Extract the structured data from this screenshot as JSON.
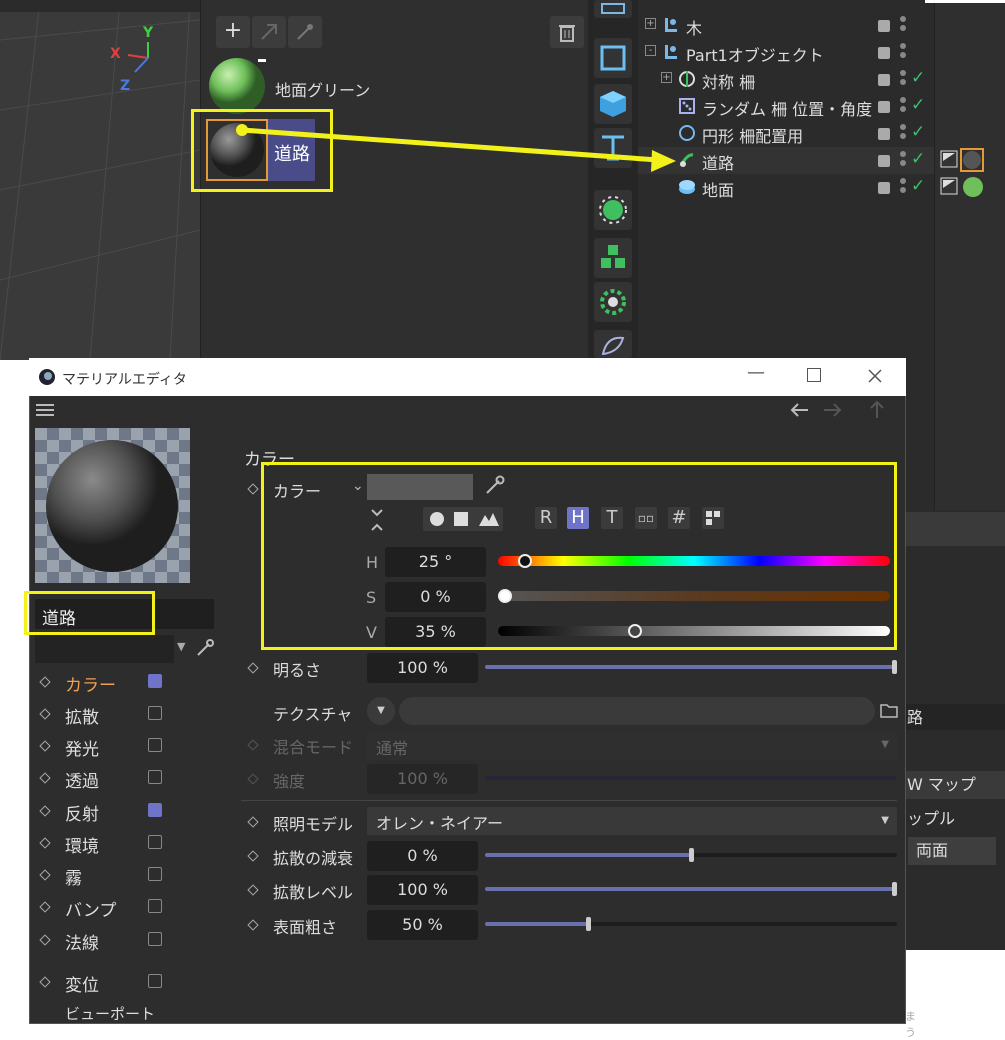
{
  "viewport": {
    "axis_x": "X",
    "axis_y": "Y",
    "axis_z": "Z"
  },
  "material_manager": {
    "add_label": "+",
    "materials": [
      {
        "name": "地面グリーン"
      },
      {
        "name": "道路"
      }
    ]
  },
  "object_manager": {
    "rows": [
      {
        "label": "木"
      },
      {
        "label": "Part1オブジェクト"
      },
      {
        "label": "対称 柵"
      },
      {
        "label": "ランダム 柵 位置・角度"
      },
      {
        "label": "円形 柵配置用"
      },
      {
        "label": "道路"
      },
      {
        "label": "地面"
      }
    ]
  },
  "side_attr": {
    "item1": "路",
    "item2": "W マップ",
    "item3": "ップル",
    "item4": "両面",
    "item5": "まう"
  },
  "material_editor": {
    "title": "マテリアルエディタ",
    "material_name": "道路",
    "channels": [
      {
        "label": "カラー",
        "checked": true
      },
      {
        "label": "拡散",
        "checked": false
      },
      {
        "label": "発光",
        "checked": false
      },
      {
        "label": "透過",
        "checked": false
      },
      {
        "label": "反射",
        "checked": true
      },
      {
        "label": "環境",
        "checked": false
      },
      {
        "label": "霧",
        "checked": false
      },
      {
        "label": "バンプ",
        "checked": false
      },
      {
        "label": "法線",
        "checked": false
      },
      {
        "label": "変位",
        "checked": false
      },
      {
        "label": "ビューポート"
      }
    ],
    "section_title": "カラー",
    "color_label": "カラー",
    "modes": [
      "R",
      "H",
      "T",
      "#"
    ],
    "h_label": "H",
    "h_value": "25 °",
    "s_label": "S",
    "s_value": "0 %",
    "v_label": "V",
    "v_value": "35 %",
    "brightness_label": "明るさ",
    "brightness_value": "100 %",
    "texture_label": "テクスチャ",
    "blend_label": "混合モード",
    "blend_value": "通常",
    "strength_label": "強度",
    "strength_value": "100 %",
    "lighting_label": "照明モデル",
    "lighting_value": "オレン・ネイアー",
    "diff_falloff_label": "拡散の減衰",
    "diff_falloff_value": "0 %",
    "diff_level_label": "拡散レベル",
    "diff_level_value": "100 %",
    "roughness_label": "表面粗さ",
    "roughness_value": "50 %",
    "hue_pos": 0.07,
    "sat_pos": 0.0,
    "val_pos": 0.35,
    "brightness_pos": 1.0,
    "diff_falloff_pos": 0.5,
    "diff_level_pos": 1.0,
    "roughness_pos": 0.25
  },
  "colors": {
    "highlight": "#f2f21a",
    "accent": "#6f74c8",
    "check": "#3fbf6f",
    "active_channel": "#f0a050"
  }
}
